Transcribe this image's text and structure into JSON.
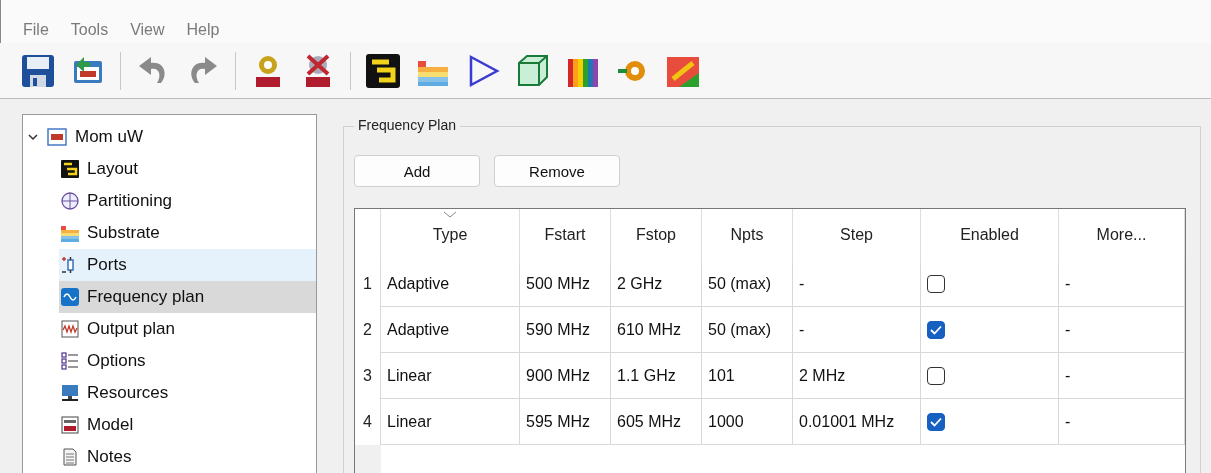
{
  "menu": [
    "File",
    "Tools",
    "View",
    "Help"
  ],
  "tree": {
    "label": "Mom uW",
    "expanded": true,
    "children": [
      {
        "label": "Layout",
        "selected": false,
        "hovered": false
      },
      {
        "label": "Partitioning",
        "selected": false,
        "hovered": false
      },
      {
        "label": "Substrate",
        "selected": false,
        "hovered": false
      },
      {
        "label": "Ports",
        "selected": false,
        "hovered": true
      },
      {
        "label": "Frequency plan",
        "selected": true,
        "hovered": false
      },
      {
        "label": "Output plan",
        "selected": false,
        "hovered": false
      },
      {
        "label": "Options",
        "selected": false,
        "hovered": false
      },
      {
        "label": "Resources",
        "selected": false,
        "hovered": false
      },
      {
        "label": "Model",
        "selected": false,
        "hovered": false
      },
      {
        "label": "Notes",
        "selected": false,
        "hovered": false
      }
    ]
  },
  "group": {
    "title": "Frequency Plan",
    "buttons": [
      "Add",
      "Remove"
    ]
  },
  "table": {
    "columns": [
      "Type",
      "Fstart",
      "Fstop",
      "Npts",
      "Step",
      "Enabled",
      "More..."
    ],
    "rows": [
      {
        "index": "1",
        "type": "Adaptive",
        "fstart": "500 MHz",
        "fstop": "2 GHz",
        "npts": "50 (max)",
        "step": "-",
        "enabled": false,
        "more": "-"
      },
      {
        "index": "2",
        "type": "Adaptive",
        "fstart": "590 MHz",
        "fstop": "610 MHz",
        "npts": "50 (max)",
        "step": "-",
        "enabled": true,
        "more": "-"
      },
      {
        "index": "3",
        "type": "Linear",
        "fstart": "900 MHz",
        "fstop": "1.1 GHz",
        "npts": "101",
        "step": "2 MHz",
        "enabled": false,
        "more": "-"
      },
      {
        "index": "4",
        "type": "Linear",
        "fstart": "595 MHz",
        "fstop": "605 MHz",
        "npts": "1000",
        "step": "0.01001 MHz",
        "enabled": true,
        "more": "-"
      }
    ]
  }
}
